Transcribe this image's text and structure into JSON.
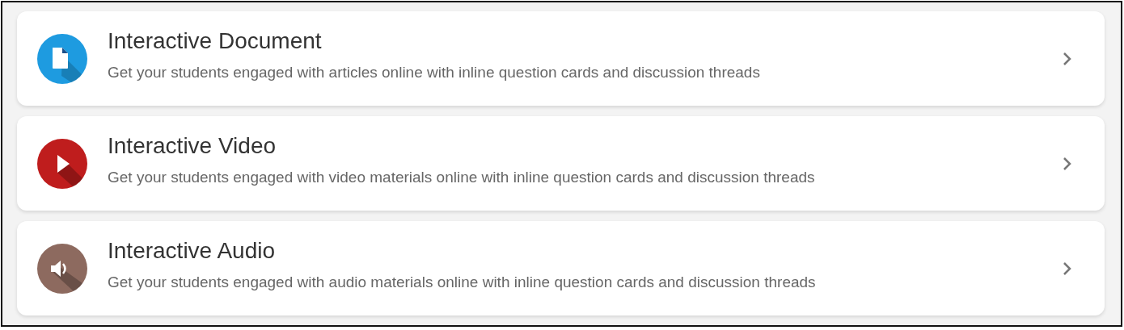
{
  "items": [
    {
      "kind": "document",
      "color": "#1e9be0",
      "title": "Interactive Document",
      "description": "Get your students engaged with articles online with inline question cards and discussion threads"
    },
    {
      "kind": "video",
      "color": "#bf1d1d",
      "title": "Interactive Video",
      "description": "Get your students engaged with video materials online with inline question cards and discussion threads"
    },
    {
      "kind": "audio",
      "color": "#8d6a5f",
      "title": "Interactive Audio",
      "description": "Get your students engaged with audio materials online with inline question cards and discussion threads"
    }
  ]
}
